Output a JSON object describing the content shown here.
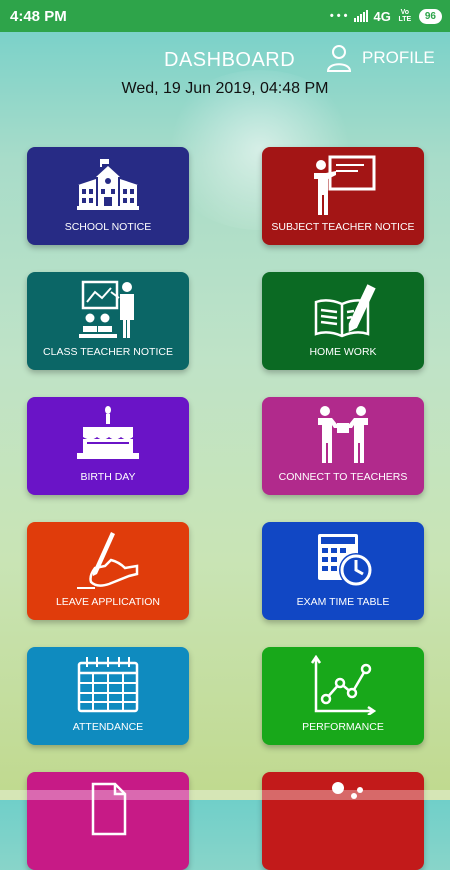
{
  "status_bar": {
    "time": "4:48 PM",
    "dots": "• • •",
    "network": "4G",
    "volte": "Vo LTE",
    "battery": "96"
  },
  "header": {
    "title": "DASHBOARD",
    "profile_label": "PROFILE",
    "datetime": "Wed, 19 Jun 2019, 04:48 PM"
  },
  "tiles": [
    {
      "label": "SCHOOL NOTICE",
      "color": "#272b85",
      "icon": "school-icon"
    },
    {
      "label": "SUBJECT TEACHER NOTICE",
      "color": "#a31515",
      "icon": "teacher-board-icon"
    },
    {
      "label": "CLASS TEACHER NOTICE",
      "color": "#0b6666",
      "icon": "class-presentation-icon"
    },
    {
      "label": "HOME WORK",
      "color": "#0b6a23",
      "icon": "book-pencil-icon"
    },
    {
      "label": "BIRTH DAY",
      "color": "#6a14c7",
      "icon": "birthday-cake-icon"
    },
    {
      "label": "CONNECT TO TEACHERS",
      "color": "#b12a8c",
      "icon": "handshake-people-icon"
    },
    {
      "label": "LEAVE APPLICATION",
      "color": "#e03c0b",
      "icon": "writing-hand-icon"
    },
    {
      "label": "EXAM TIME TABLE",
      "color": "#1147c4",
      "icon": "calendar-clock-icon"
    },
    {
      "label": "ATTENDANCE",
      "color": "#0f8bbf",
      "icon": "calendar-icon"
    },
    {
      "label": "PERFORMANCE",
      "color": "#18a81a",
      "icon": "line-chart-icon"
    },
    {
      "label": "",
      "color": "#c71a86",
      "icon": "document-icon"
    },
    {
      "label": "",
      "color": "#c21a1a",
      "icon": "person-icon"
    }
  ]
}
